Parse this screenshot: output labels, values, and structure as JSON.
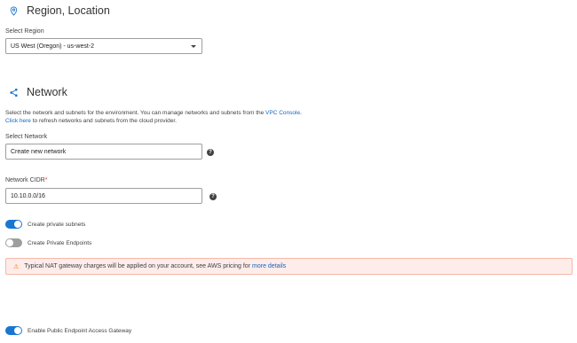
{
  "region": {
    "title": "Region, Location",
    "select_label": "Select Region",
    "selected_value": "US West (Oregon) - us-west-2"
  },
  "network": {
    "title": "Network",
    "description_line1": "Select the network and subnets for the environment. You can manage networks and subnets from the ",
    "vpc_link": "VPC Console",
    "description_line1_end": ".",
    "click_here": "Click here",
    "description_line2": " to refresh networks and subnets from the cloud provider.",
    "select_network_label": "Select Network",
    "select_network_value": "Create new network",
    "cidr_label": "Network CIDR",
    "cidr_required": "*",
    "cidr_value": "10.10.0.0/16"
  },
  "toggles": [
    {
      "label": "Create private subnets",
      "on": true
    },
    {
      "label": "Create Private Endpoints",
      "on": false
    },
    {
      "label": "Enable Public Endpoint Access Gateway",
      "on": true
    }
  ],
  "warning": {
    "text": "Typical NAT gateway charges will be applied on your account, see AWS pricing for ",
    "link": "more details"
  },
  "icons": {
    "region": "location-pin-icon",
    "network": "share-network-icon",
    "help": "help-circle-icon",
    "warning": "warning-triangle-icon"
  },
  "colors": {
    "accent": "#1976d2",
    "link": "#1565c0",
    "warning_bg": "#fdecea",
    "warning_icon": "#ef6c00"
  }
}
